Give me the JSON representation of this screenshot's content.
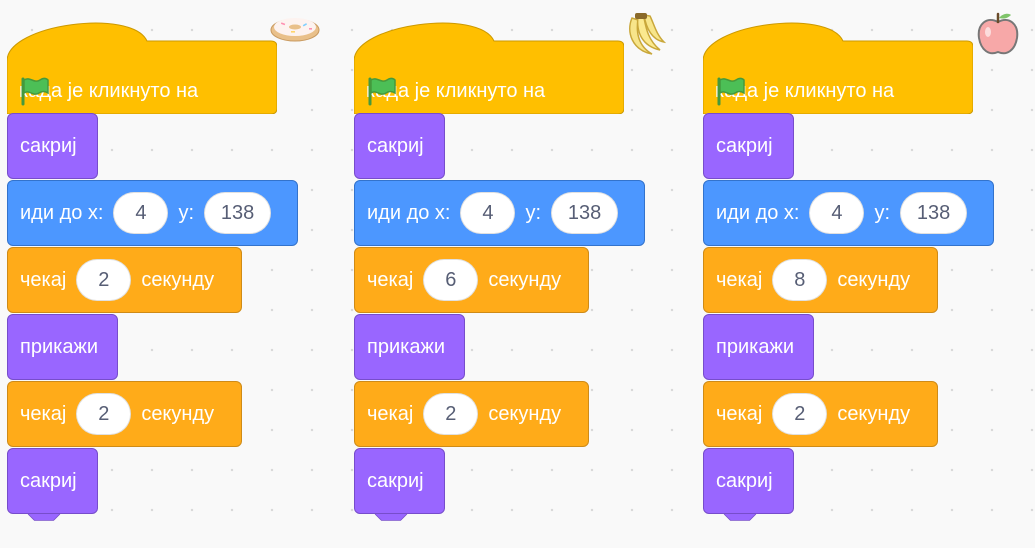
{
  "scripts": [
    {
      "sprite_icon": "donut-sprite-icon",
      "hat_label": "када је кликнуто на",
      "hide_label": "сакриј",
      "goto_label": "иди до x:",
      "goto_x": "4",
      "goto_y_label": "y:",
      "goto_y": "138",
      "wait1_label": "чекај",
      "wait1_value": "2",
      "wait1_unit": "секунду",
      "show_label": "прикажи",
      "wait2_label": "чекај",
      "wait2_value": "2",
      "wait2_unit": "секунду",
      "hide2_label": "сакриј"
    },
    {
      "sprite_icon": "bananas-sprite-icon",
      "hat_label": "када је кликнуто на",
      "hide_label": "сакриј",
      "goto_label": "иди до x:",
      "goto_x": "4",
      "goto_y_label": "y:",
      "goto_y": "138",
      "wait1_label": "чекај",
      "wait1_value": "6",
      "wait1_unit": "секунду",
      "show_label": "прикажи",
      "wait2_label": "чекај",
      "wait2_value": "2",
      "wait2_unit": "секунду",
      "hide2_label": "сакриј"
    },
    {
      "sprite_icon": "apple-sprite-icon",
      "hat_label": "када је кликнуто на",
      "hide_label": "сакриј",
      "goto_label": "иди до x:",
      "goto_x": "4",
      "goto_y_label": "y:",
      "goto_y": "138",
      "wait1_label": "чекај",
      "wait1_value": "8",
      "wait1_unit": "секунду",
      "show_label": "прикажи",
      "wait2_label": "чекај",
      "wait2_value": "2",
      "wait2_unit": "секунду",
      "hide2_label": "сакриј"
    }
  ],
  "colors": {
    "events": "#ffbf00",
    "looks": "#9966ff",
    "motion": "#4c97ff",
    "control": "#ffab19",
    "flag": "#4cbf56"
  }
}
